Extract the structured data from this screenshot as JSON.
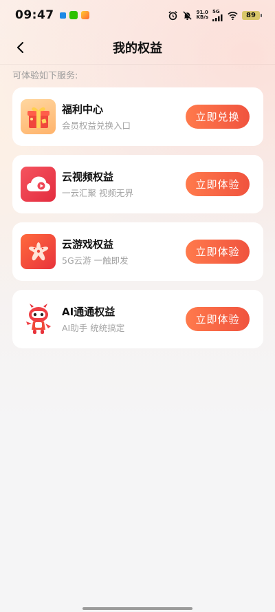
{
  "status_bar": {
    "time": "09:47",
    "network_speed_value": "91.0",
    "network_speed_unit": "KB/s",
    "network_type": "5G",
    "battery": "89"
  },
  "header": {
    "title": "我的权益"
  },
  "subtitle": "可体验如下服务:",
  "cards": [
    {
      "title": "福利中心",
      "desc": "会员权益兑换入口",
      "button": "立即兑换",
      "icon": "gift-icon"
    },
    {
      "title": "云视频权益",
      "desc": "一云汇聚 视频无界",
      "button": "立即体验",
      "icon": "cloud-video-icon"
    },
    {
      "title": "云游戏权益",
      "desc": "5G云游 一触即发",
      "button": "立即体验",
      "icon": "cloud-game-icon"
    },
    {
      "title": "AI通通权益",
      "desc": "AI助手 统统搞定",
      "button": "立即体验",
      "icon": "ai-mascot-icon"
    }
  ],
  "colors": {
    "accent_start": "#ff7a4c",
    "accent_end": "#f0533e",
    "video_icon_bg": "#ee3b4b",
    "game_icon_bg": "#f04a3a"
  }
}
